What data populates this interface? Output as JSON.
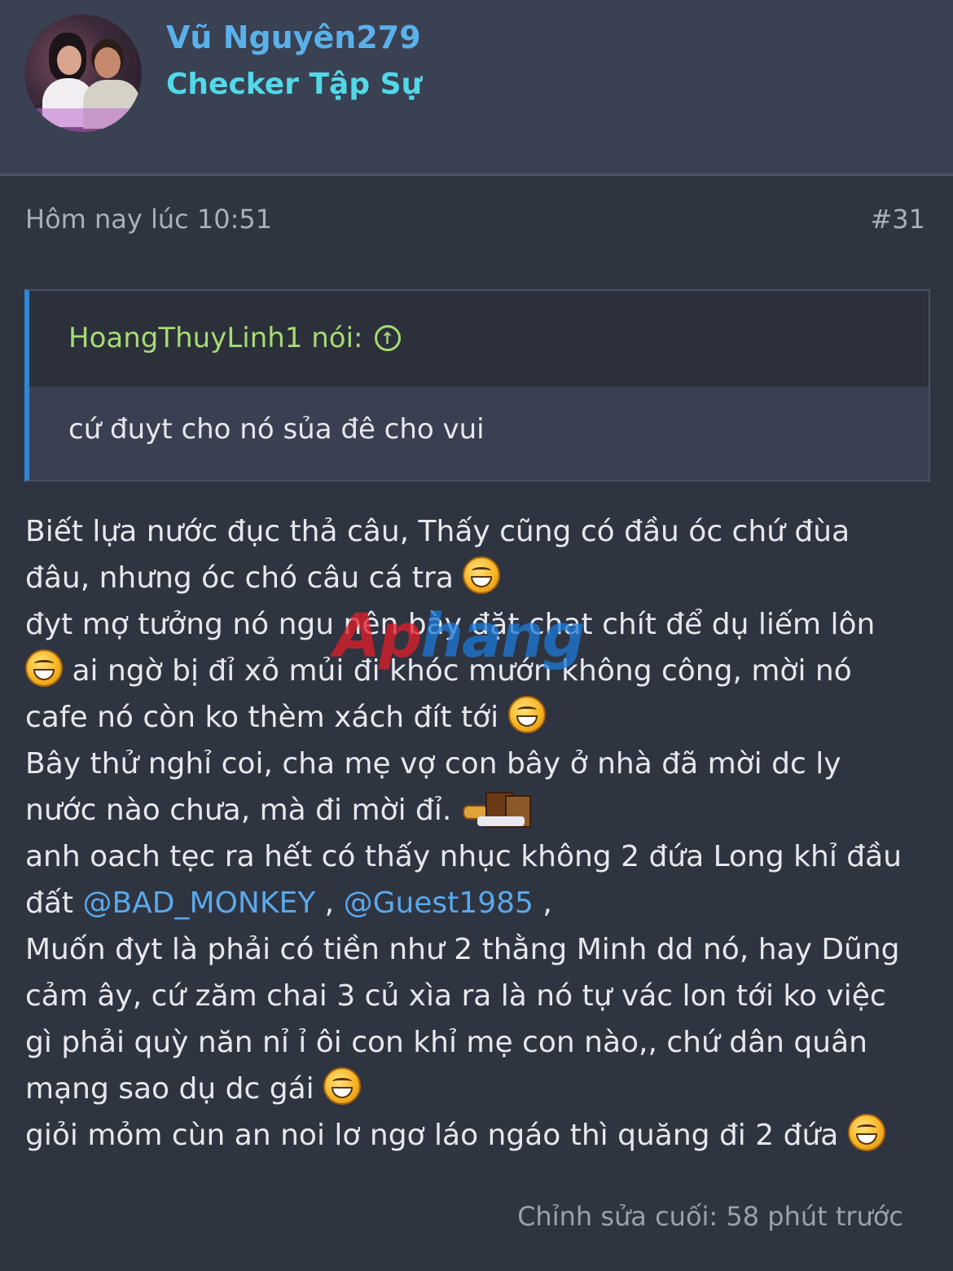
{
  "profile": {
    "username": "Vũ Nguyên279",
    "user_title": "Checker Tập Sự"
  },
  "post": {
    "date": "Hôm nay lúc 10:51",
    "number": "#31",
    "quote": {
      "author": "HoangThuyLinh1 nói:",
      "text": "cứ đuyt cho nó sủa đê cho vui"
    },
    "lines": [
      "Biết lựa nước đục thả câu, Thấy cũng có đầu óc chứ đùa",
      "đâu, nhưng óc chó câu cá tra",
      "đyt mợ tưởng nó ngu nên bày đặt chat chít để dụ liếm lôn",
      "ai ngờ bị đỉ xỏ mủi đi khóc mướn không công, mời nó",
      "cafe nó còn ko thèm xách đít tới",
      "Bây thử nghỉ coi, cha mẹ vợ con bây ở nhà đã mời dc ly",
      "nước nào chưa, mà đi mời đỉ.",
      "anh oach tẹc ra hết có thấy nhục không 2 đứa Long khỉ đầu",
      "đất",
      "Muốn đyt là phải có tiền như 2 thằng Minh dd nó, hay Dũng",
      "cảm ây, cứ zăm chai 3 củ xìa ra là nó tự vác lon tới ko việc",
      "gì phải quỳ năn nỉ ỉ ôi con khỉ mẹ con nào,, chứ dân quân",
      "mạng sao dụ dc gái",
      "giỏi mỏm cùn an noi lơ ngơ láo ngáo thì quăng đi 2 đứa"
    ],
    "mentions": [
      "@BAD_MONKEY",
      "@Guest1985"
    ],
    "separators": [
      ",",
      ","
    ],
    "edited": "Chỉnh sửa cuối: 58 phút trước"
  },
  "watermark": {
    "part1": "Ap",
    "part2": "hang"
  },
  "icons": [
    "laughing-emoji-icon",
    "coffee-sticker-icon",
    "quote-jump-arrow-icon"
  ],
  "colors": {
    "background": "#2f3441",
    "username": "#5ab1ea",
    "user_title": "#52d8e9",
    "quote_author": "#a6db72",
    "mention": "#5aa9ea",
    "quote_border": "#2f86d4"
  }
}
